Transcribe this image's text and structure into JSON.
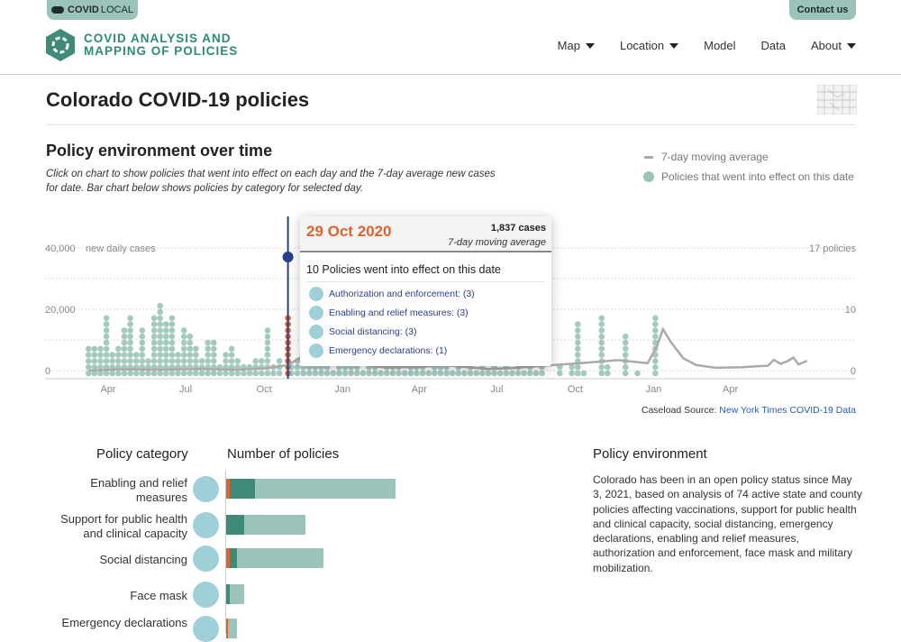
{
  "topbar": {
    "brand_bold": "COVID",
    "brand_light": "LOCAL",
    "contact": "Contact us"
  },
  "logo": {
    "line1": "COVID ANALYSIS AND",
    "line2": "MAPPING OF POLICIES"
  },
  "nav": [
    {
      "label": "Map",
      "dropdown": true
    },
    {
      "label": "Location",
      "dropdown": true
    },
    {
      "label": "Model",
      "dropdown": false
    },
    {
      "label": "Data",
      "dropdown": false
    },
    {
      "label": "About",
      "dropdown": true
    }
  ],
  "page_title": "Colorado COVID-19 policies",
  "section_title": "Policy environment over time",
  "section_sub": "Click on chart to show policies that went into effect on each day and the 7-day average new cases for date. Bar chart below shows policies by category for selected day.",
  "legend": {
    "line": "7-day moving average",
    "dot": "Policies that went into effect on this date"
  },
  "colors": {
    "teal": "#5a9e8c",
    "teal_light": "#9cc3b9",
    "teal_dark": "#3f8a78",
    "selected": "#e0622f",
    "cursor": "#2b3f8c",
    "line": "#aaaaaa"
  },
  "tooltip": {
    "date": "29 Oct 2020",
    "cases": "1,837 cases",
    "cases_label": "7-day moving average",
    "count_text": "10 Policies went into effect on this date",
    "items": [
      {
        "icon": "police-officer-icon",
        "label": "Authorization and enforcement: (3)"
      },
      {
        "icon": "hand-relief-icon",
        "label": "Enabling and relief measures: (3)"
      },
      {
        "icon": "social-distancing-icon",
        "label": "Social distancing: (3)"
      },
      {
        "icon": "emergency-document-icon",
        "label": "Emergency declarations: (1)"
      }
    ]
  },
  "source": {
    "label": "Caseload Source: ",
    "link": "New York Times COVID-19 Data"
  },
  "chart_data": {
    "type": "scatter",
    "left_axis": {
      "label": "new daily cases",
      "ticks": [
        {
          "v": 0,
          "t": "0"
        },
        {
          "v": 20000,
          "t": "20,000"
        },
        {
          "v": 40000,
          "t": "40,000"
        }
      ],
      "range": [
        0,
        40000
      ]
    },
    "right_axis": {
      "ticks": [
        {
          "v": 0,
          "t": "0"
        },
        {
          "v": 10,
          "t": "10"
        },
        {
          "v": 17,
          "t": "17 policies"
        }
      ]
    },
    "x_ticks": [
      {
        "d": "2020-04-01",
        "t": "Apr"
      },
      {
        "d": "2020-07-01",
        "t": "Jul"
      },
      {
        "d": "2020-10-01",
        "t": "Oct"
      },
      {
        "d": "2021-01-01",
        "t": "Jan"
      },
      {
        "d": "2021-04-01",
        "t": "Apr"
      },
      {
        "d": "2021-07-01",
        "t": "Jul"
      },
      {
        "d": "2021-10-01",
        "t": "Oct"
      },
      {
        "d": "2022-01-01",
        "t": "Jan"
      },
      {
        "d": "2022-04-01",
        "t": "Apr"
      }
    ],
    "grid": true,
    "selected_date": "2020-10-29",
    "policies": [
      [
        "2020-03-09",
        5
      ],
      [
        "2020-03-16",
        5
      ],
      [
        "2020-03-23",
        5
      ],
      [
        "2020-03-30",
        10
      ],
      [
        "2020-04-06",
        4
      ],
      [
        "2020-04-13",
        5
      ],
      [
        "2020-04-20",
        8
      ],
      [
        "2020-04-27",
        10
      ],
      [
        "2020-05-04",
        4
      ],
      [
        "2020-05-11",
        8
      ],
      [
        "2020-05-18",
        3
      ],
      [
        "2020-05-25",
        10
      ],
      [
        "2020-06-01",
        12
      ],
      [
        "2020-06-08",
        9
      ],
      [
        "2020-06-15",
        10
      ],
      [
        "2020-06-22",
        4
      ],
      [
        "2020-06-29",
        8
      ],
      [
        "2020-07-06",
        7
      ],
      [
        "2020-07-13",
        5
      ],
      [
        "2020-07-20",
        3
      ],
      [
        "2020-07-27",
        6
      ],
      [
        "2020-08-03",
        6
      ],
      [
        "2020-08-10",
        2
      ],
      [
        "2020-08-17",
        4
      ],
      [
        "2020-08-24",
        5
      ],
      [
        "2020-08-31",
        3
      ],
      [
        "2020-09-07",
        2
      ],
      [
        "2020-09-14",
        2
      ],
      [
        "2020-09-21",
        3
      ],
      [
        "2020-09-28",
        3
      ],
      [
        "2020-10-05",
        8
      ],
      [
        "2020-10-12",
        2
      ],
      [
        "2020-10-19",
        3
      ],
      [
        "2020-10-29",
        10
      ],
      [
        "2020-11-02",
        2
      ],
      [
        "2020-11-09",
        3
      ],
      [
        "2020-11-16",
        2
      ],
      [
        "2020-11-23",
        2
      ],
      [
        "2020-11-30",
        3
      ],
      [
        "2020-12-07",
        2
      ],
      [
        "2020-12-14",
        2
      ],
      [
        "2020-12-21",
        1
      ],
      [
        "2020-12-28",
        2
      ],
      [
        "2021-01-04",
        2
      ],
      [
        "2021-01-11",
        2
      ],
      [
        "2021-01-18",
        2
      ],
      [
        "2021-01-25",
        1
      ],
      [
        "2021-02-01",
        2
      ],
      [
        "2021-02-08",
        2
      ],
      [
        "2021-02-15",
        1
      ],
      [
        "2021-02-22",
        2
      ],
      [
        "2021-03-01",
        2
      ],
      [
        "2021-03-08",
        2
      ],
      [
        "2021-03-15",
        1
      ],
      [
        "2021-03-22",
        2
      ],
      [
        "2021-03-29",
        2
      ],
      [
        "2021-04-05",
        2
      ],
      [
        "2021-04-12",
        1
      ],
      [
        "2021-04-19",
        2
      ],
      [
        "2021-04-26",
        2
      ],
      [
        "2021-05-03",
        2
      ],
      [
        "2021-05-10",
        1
      ],
      [
        "2021-05-17",
        2
      ],
      [
        "2021-05-24",
        1
      ],
      [
        "2021-05-31",
        2
      ],
      [
        "2021-06-07",
        1
      ],
      [
        "2021-06-14",
        2
      ],
      [
        "2021-06-21",
        1
      ],
      [
        "2021-06-28",
        2
      ],
      [
        "2021-07-05",
        1
      ],
      [
        "2021-07-12",
        2
      ],
      [
        "2021-07-19",
        1
      ],
      [
        "2021-07-26",
        2
      ],
      [
        "2021-08-02",
        1
      ],
      [
        "2021-08-09",
        2
      ],
      [
        "2021-08-16",
        1
      ],
      [
        "2021-08-23",
        2
      ],
      [
        "2021-09-13",
        2
      ],
      [
        "2021-09-27",
        2
      ],
      [
        "2021-10-04",
        9
      ],
      [
        "2021-10-11",
        1
      ],
      [
        "2021-11-01",
        10
      ],
      [
        "2021-11-08",
        2
      ],
      [
        "2021-11-29",
        7
      ],
      [
        "2021-12-13",
        1
      ],
      [
        "2022-01-03",
        10
      ]
    ],
    "cases_7day": [
      [
        "2020-03-10",
        0
      ],
      [
        "2020-04-15",
        450
      ],
      [
        "2020-06-01",
        300
      ],
      [
        "2020-07-15",
        500
      ],
      [
        "2020-09-01",
        300
      ],
      [
        "2020-10-01",
        700
      ],
      [
        "2020-10-29",
        1837
      ],
      [
        "2020-11-20",
        5500
      ],
      [
        "2020-12-10",
        4600
      ],
      [
        "2021-01-10",
        2500
      ],
      [
        "2021-02-20",
        1000
      ],
      [
        "2021-04-01",
        1200
      ],
      [
        "2021-05-01",
        1800
      ],
      [
        "2021-06-20",
        500
      ],
      [
        "2021-07-20",
        800
      ],
      [
        "2021-08-20",
        1500
      ],
      [
        "2021-10-01",
        2300
      ],
      [
        "2021-11-20",
        3400
      ],
      [
        "2021-12-25",
        2400
      ],
      [
        "2022-01-05",
        8000
      ],
      [
        "2022-01-12",
        13500
      ],
      [
        "2022-01-22",
        9000
      ],
      [
        "2022-02-05",
        4000
      ],
      [
        "2022-02-20",
        1800
      ],
      [
        "2022-03-15",
        900
      ],
      [
        "2022-04-15",
        1100
      ],
      [
        "2022-05-01",
        1400
      ],
      [
        "2022-05-15",
        1600
      ],
      [
        "2022-05-22",
        3500
      ],
      [
        "2022-05-30",
        2200
      ],
      [
        "2022-06-08",
        3200
      ],
      [
        "2022-06-14",
        4300
      ],
      [
        "2022-06-20",
        2000
      ],
      [
        "2022-06-30",
        3200
      ]
    ]
  },
  "categories": {
    "header_left": "Policy category",
    "header_right": "Number of policies",
    "items": [
      {
        "label": "Enabling and relief measures",
        "icon": "hand-relief-icon",
        "selected": 1,
        "new": 7,
        "total": 47
      },
      {
        "label": "Support for public health and clinical capacity",
        "icon": "hospital-bed-icon",
        "selected": 0,
        "new": 5,
        "total": 22
      },
      {
        "label": "Social distancing",
        "icon": "social-distancing-icon",
        "selected": 1,
        "new": 2,
        "total": 27
      },
      {
        "label": "Face mask",
        "icon": "face-mask-icon",
        "selected": 0,
        "new": 1,
        "total": 5
      },
      {
        "label": "Emergency declarations",
        "icon": "emergency-document-icon",
        "selected": 0.5,
        "new": 0,
        "total": 3
      }
    ]
  },
  "environment": {
    "title": "Policy environment",
    "text": "Colorado has been in an open policy status since May 3, 2021, based on analysis of 74 active state and county policies affecting vaccinations, support for public health and clinical capacity, social distancing, emergency declarations, enabling and relief measures, authorization and enforcement, face mask and military mobilization."
  }
}
